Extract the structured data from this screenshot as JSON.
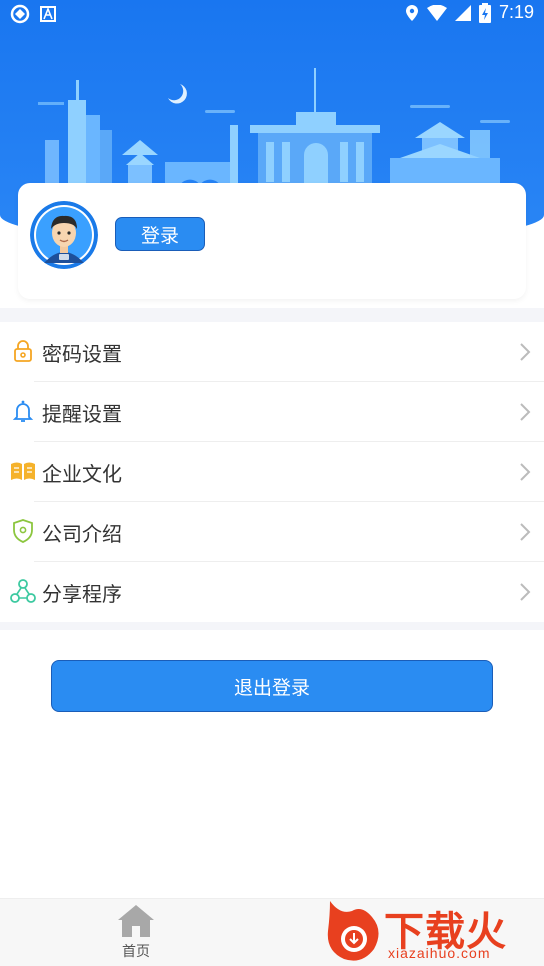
{
  "status_bar": {
    "time": "7:19",
    "left_icons": [
      "app-notification-icon",
      "font-app-icon"
    ],
    "right_icons": [
      "location-icon",
      "wifi-icon",
      "signal-icon",
      "battery-icon"
    ]
  },
  "colors": {
    "primary": "#2a8cf2",
    "header_blue": "#1976f0",
    "page_bg": "#f4f5f9",
    "text": "#333333",
    "chevron": "#bbbbbb"
  },
  "profile": {
    "avatar_icon": "user-avatar",
    "login_label": "登录"
  },
  "menu": [
    {
      "id": "password",
      "label": "密码设置",
      "icon": "lock-icon",
      "icon_color": "#f5a623"
    },
    {
      "id": "reminder",
      "label": "提醒设置",
      "icon": "bell-icon",
      "icon_color": "#2a8cf2"
    },
    {
      "id": "culture",
      "label": "企业文化",
      "icon": "book-icon",
      "icon_color": "#f5a623"
    },
    {
      "id": "company",
      "label": "公司介绍",
      "icon": "shield-icon",
      "icon_color": "#8cc63f"
    },
    {
      "id": "share",
      "label": "分享程序",
      "icon": "share-icon",
      "icon_color": "#3cc9a0"
    }
  ],
  "logout_label": "退出登录",
  "tabbar": {
    "home_label": "首页",
    "home_icon": "home-icon"
  },
  "watermark": {
    "text": "下载火",
    "sub": "xiazaihuo.com"
  }
}
